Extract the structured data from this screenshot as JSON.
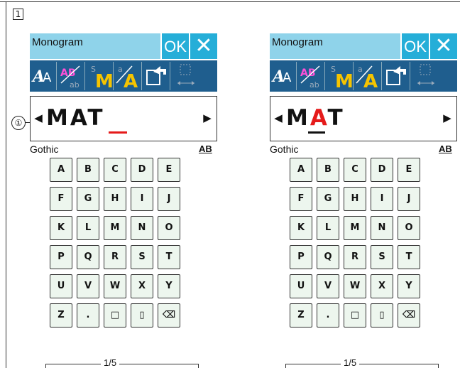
{
  "step_marker": "1",
  "callout": "①",
  "screens": [
    {
      "title": "Monogram",
      "ok_label": "OK",
      "close_label": "✕",
      "text_before": "MAT",
      "text_highlight": "",
      "text_after": "",
      "font_name": "Gothic",
      "text_size_label": "AB",
      "page_indicator": "1/5"
    },
    {
      "title": "Monogram",
      "ok_label": "OK",
      "close_label": "✕",
      "text_before": "M",
      "text_highlight": "A",
      "text_after": "T",
      "font_name": "Gothic",
      "text_size_label": "AB",
      "page_indicator": "1/5"
    }
  ],
  "keyboard_rows": [
    [
      "A",
      "B",
      "C",
      "D",
      "E"
    ],
    [
      "F",
      "G",
      "H",
      "I",
      "J"
    ],
    [
      "K",
      "L",
      "M",
      "N",
      "O"
    ],
    [
      "P",
      "Q",
      "R",
      "S",
      "T"
    ],
    [
      "U",
      "V",
      "W",
      "X",
      "Y"
    ],
    [
      "Z",
      ".",
      "□",
      "▯",
      "⌫"
    ]
  ],
  "accent_colors": {
    "titlebar": "#8fd3ea",
    "ok": "#25aed8",
    "toolbar": "#1f5e8e",
    "cursor": "#e51a1a",
    "key": "#edf6ee"
  }
}
